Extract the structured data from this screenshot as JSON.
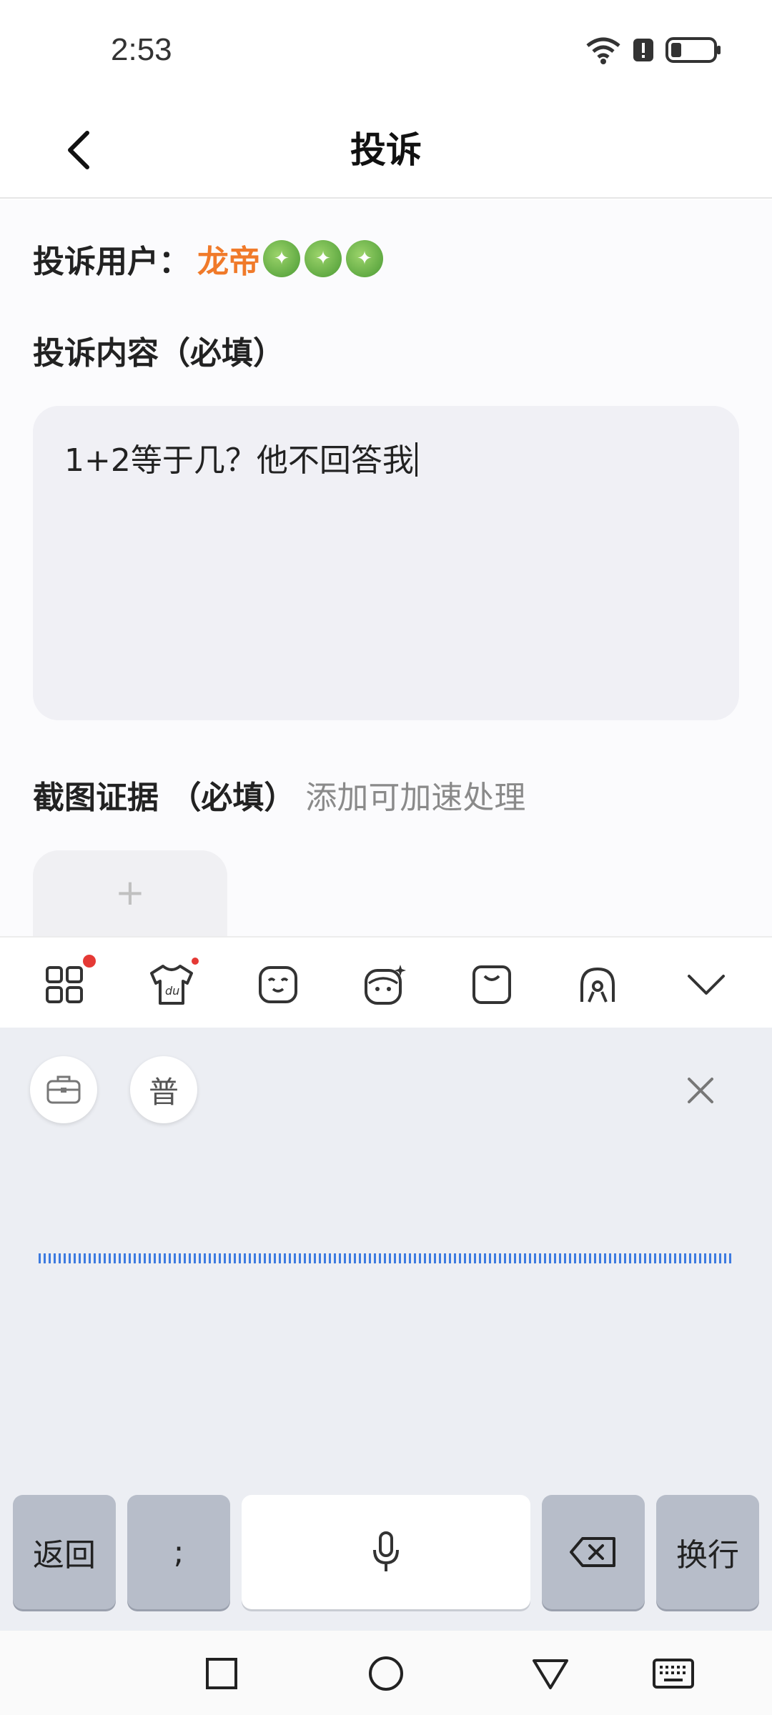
{
  "status": {
    "time": "2:53"
  },
  "nav": {
    "title": "投诉"
  },
  "form": {
    "user_label": "投诉用户：",
    "user_name": "龙帝",
    "content_label": "投诉内容（必填）",
    "content_value": "1+2等于几？他不回答我",
    "evidence_label": "截图证据 （必填）",
    "evidence_hint": "添加可加速处理",
    "upload_symbol": "+"
  },
  "ime": {
    "chip_mode_label": "普",
    "keys": {
      "back": "返回",
      "semicolon": ";",
      "newline": "换行"
    }
  }
}
